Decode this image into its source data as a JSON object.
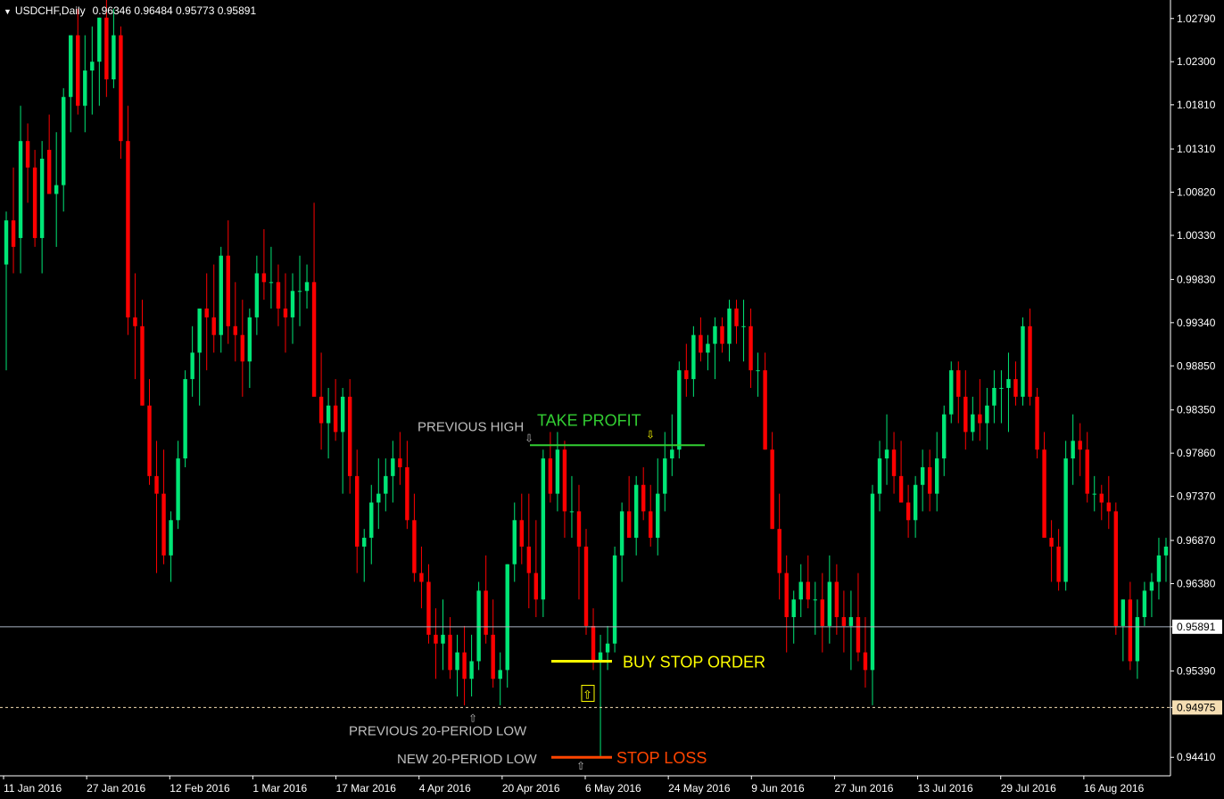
{
  "header": {
    "symbol": "USDCHF,Daily",
    "ohlc": "0.96346 0.96484 0.95773 0.95891"
  },
  "colors": {
    "background": "#000000",
    "bull": "#00E676",
    "bear": "#FF0000",
    "axis": "#FFFFFF",
    "current_price_line": "#A9B4C2",
    "take_profit": "#32CD32",
    "buy_stop": "#FFFF00",
    "stop_loss": "#FF4500",
    "annotation_gray": "#BEBEBE",
    "price_tag_bg": "#F5DEB3"
  },
  "chart_data": {
    "type": "candlestick",
    "symbol": "USDCHF",
    "timeframe": "Daily",
    "ylim": [
      0.942,
      1.03
    ],
    "y_ticks": [
      "1.02790",
      "1.02300",
      "1.01810",
      "1.01310",
      "1.00820",
      "1.00330",
      "0.99830",
      "0.99340",
      "0.98850",
      "0.98350",
      "0.97860",
      "0.97370",
      "0.96870",
      "0.96380",
      "0.95891",
      "0.95390",
      "0.94975",
      "0.94410"
    ],
    "x_labels": [
      "11 Jan 2016",
      "27 Jan 2016",
      "12 Feb 2016",
      "1 Mar 2016",
      "17 Mar 2016",
      "4 Apr 2016",
      "20 Apr 2016",
      "6 May 2016",
      "24 May 2016",
      "9 Jun 2016",
      "27 Jun 2016",
      "13 Jul 2016",
      "29 Jul 2016",
      "16 Aug 2016"
    ],
    "current_price": 0.95891,
    "dotted_level": 0.94975,
    "candles": [
      [
        1.0,
        1.006,
        0.988,
        1.005
      ],
      [
        1.005,
        1.011,
        0.999,
        1.002
      ],
      [
        1.003,
        1.018,
        0.999,
        1.014
      ],
      [
        1.014,
        1.016,
        1.007,
        1.011
      ],
      [
        1.011,
        1.013,
        1.002,
        1.003
      ],
      [
        1.003,
        1.014,
        0.999,
        1.012
      ],
      [
        1.013,
        1.017,
        1.008,
        1.008
      ],
      [
        1.008,
        1.015,
        1.002,
        1.009
      ],
      [
        1.009,
        1.02,
        1.006,
        1.019
      ],
      [
        1.019,
        1.026,
        1.015,
        1.026
      ],
      [
        1.026,
        1.029,
        1.017,
        1.018
      ],
      [
        1.018,
        1.026,
        1.015,
        1.022
      ],
      [
        1.022,
        1.027,
        1.017,
        1.023
      ],
      [
        1.023,
        1.028,
        1.018,
        1.028
      ],
      [
        1.028,
        1.034,
        1.019,
        1.021
      ],
      [
        1.021,
        1.029,
        1.02,
        1.026
      ],
      [
        1.026,
        1.027,
        1.012,
        1.014
      ],
      [
        1.014,
        1.018,
        0.992,
        0.994
      ],
      [
        0.994,
        0.999,
        0.987,
        0.993
      ],
      [
        0.993,
        0.996,
        0.984,
        0.984
      ],
      [
        0.984,
        0.987,
        0.975,
        0.976
      ],
      [
        0.976,
        0.98,
        0.965,
        0.974
      ],
      [
        0.974,
        0.979,
        0.966,
        0.967
      ],
      [
        0.967,
        0.972,
        0.964,
        0.971
      ],
      [
        0.971,
        0.98,
        0.97,
        0.978
      ],
      [
        0.978,
        0.988,
        0.977,
        0.987
      ],
      [
        0.987,
        0.993,
        0.985,
        0.99
      ],
      [
        0.99,
        0.995,
        0.984,
        0.995
      ],
      [
        0.995,
        0.999,
        0.988,
        0.994
      ],
      [
        0.994,
        1.0,
        0.99,
        0.992
      ],
      [
        0.992,
        1.002,
        0.99,
        1.001
      ],
      [
        1.001,
        1.005,
        0.991,
        0.993
      ],
      [
        0.993,
        0.998,
        0.989,
        0.992
      ],
      [
        0.992,
        0.996,
        0.985,
        0.989
      ],
      [
        0.989,
        0.995,
        0.986,
        0.994
      ],
      [
        0.994,
        1.001,
        0.992,
        0.999
      ],
      [
        0.999,
        1.004,
        0.996,
        0.998
      ],
      [
        0.998,
        1.002,
        0.995,
        0.998
      ],
      [
        0.998,
        1.0,
        0.993,
        0.995
      ],
      [
        0.995,
        0.999,
        0.99,
        0.994
      ],
      [
        0.994,
        0.999,
        0.991,
        0.997
      ],
      [
        0.997,
        1.001,
        0.993,
        0.997
      ],
      [
        0.997,
        1.0,
        0.995,
        0.998
      ],
      [
        0.998,
        1.007,
        0.991,
        0.985
      ],
      [
        0.985,
        0.99,
        0.979,
        0.982
      ],
      [
        0.982,
        0.986,
        0.978,
        0.984
      ],
      [
        0.984,
        0.987,
        0.98,
        0.981
      ],
      [
        0.981,
        0.986,
        0.974,
        0.985
      ],
      [
        0.985,
        0.987,
        0.974,
        0.976
      ],
      [
        0.976,
        0.979,
        0.965,
        0.968
      ],
      [
        0.968,
        0.97,
        0.964,
        0.969
      ],
      [
        0.969,
        0.975,
        0.966,
        0.973
      ],
      [
        0.973,
        0.978,
        0.97,
        0.974
      ],
      [
        0.974,
        0.978,
        0.972,
        0.976
      ],
      [
        0.976,
        0.98,
        0.973,
        0.978
      ],
      [
        0.978,
        0.981,
        0.975,
        0.977
      ],
      [
        0.977,
        0.98,
        0.97,
        0.971
      ],
      [
        0.971,
        0.974,
        0.964,
        0.965
      ],
      [
        0.965,
        0.968,
        0.961,
        0.964
      ],
      [
        0.964,
        0.966,
        0.957,
        0.958
      ],
      [
        0.958,
        0.961,
        0.953,
        0.957
      ],
      [
        0.957,
        0.962,
        0.954,
        0.958
      ],
      [
        0.958,
        0.96,
        0.953,
        0.954
      ],
      [
        0.954,
        0.958,
        0.951,
        0.956
      ],
      [
        0.956,
        0.959,
        0.95,
        0.953
      ],
      [
        0.953,
        0.958,
        0.951,
        0.955
      ],
      [
        0.955,
        0.964,
        0.954,
        0.963
      ],
      [
        0.963,
        0.967,
        0.957,
        0.958
      ],
      [
        0.958,
        0.962,
        0.952,
        0.953
      ],
      [
        0.953,
        0.956,
        0.95,
        0.954
      ],
      [
        0.954,
        0.966,
        0.952,
        0.966
      ],
      [
        0.966,
        0.973,
        0.964,
        0.971
      ],
      [
        0.971,
        0.974,
        0.966,
        0.968
      ],
      [
        0.968,
        0.974,
        0.961,
        0.965
      ],
      [
        0.965,
        0.971,
        0.96,
        0.962
      ],
      [
        0.962,
        0.979,
        0.96,
        0.978
      ],
      [
        0.978,
        0.981,
        0.973,
        0.974
      ],
      [
        0.974,
        0.981,
        0.972,
        0.979
      ],
      [
        0.979,
        0.98,
        0.969,
        0.972
      ],
      [
        0.972,
        0.976,
        0.969,
        0.972
      ],
      [
        0.972,
        0.975,
        0.962,
        0.968
      ],
      [
        0.968,
        0.97,
        0.958,
        0.959
      ],
      [
        0.959,
        0.961,
        0.954,
        0.955
      ],
      [
        0.955,
        0.958,
        0.944,
        0.956
      ],
      [
        0.956,
        0.959,
        0.954,
        0.957
      ],
      [
        0.957,
        0.968,
        0.956,
        0.967
      ],
      [
        0.967,
        0.973,
        0.964,
        0.972
      ],
      [
        0.972,
        0.976,
        0.969,
        0.969
      ],
      [
        0.969,
        0.976,
        0.967,
        0.975
      ],
      [
        0.975,
        0.977,
        0.971,
        0.972
      ],
      [
        0.972,
        0.975,
        0.968,
        0.969
      ],
      [
        0.969,
        0.978,
        0.967,
        0.974
      ],
      [
        0.974,
        0.981,
        0.972,
        0.978
      ],
      [
        0.978,
        0.983,
        0.976,
        0.979
      ],
      [
        0.979,
        0.989,
        0.978,
        0.988
      ],
      [
        0.988,
        0.991,
        0.985,
        0.987
      ],
      [
        0.987,
        0.993,
        0.985,
        0.992
      ],
      [
        0.992,
        0.994,
        0.989,
        0.99
      ],
      [
        0.99,
        0.992,
        0.988,
        0.991
      ],
      [
        0.991,
        0.994,
        0.987,
        0.993
      ],
      [
        0.993,
        0.994,
        0.99,
        0.991
      ],
      [
        0.991,
        0.996,
        0.989,
        0.995
      ],
      [
        0.995,
        0.996,
        0.991,
        0.993
      ],
      [
        0.993,
        0.996,
        0.989,
        0.993
      ],
      [
        0.993,
        0.995,
        0.986,
        0.988
      ],
      [
        0.988,
        0.99,
        0.985,
        0.988
      ],
      [
        0.988,
        0.99,
        0.979,
        0.979
      ],
      [
        0.979,
        0.981,
        0.97,
        0.97
      ],
      [
        0.97,
        0.974,
        0.962,
        0.965
      ],
      [
        0.965,
        0.967,
        0.956,
        0.96
      ],
      [
        0.96,
        0.963,
        0.957,
        0.962
      ],
      [
        0.962,
        0.966,
        0.96,
        0.964
      ],
      [
        0.964,
        0.967,
        0.961,
        0.962
      ],
      [
        0.962,
        0.964,
        0.958,
        0.962
      ],
      [
        0.962,
        0.965,
        0.956,
        0.959
      ],
      [
        0.959,
        0.967,
        0.957,
        0.964
      ],
      [
        0.964,
        0.966,
        0.958,
        0.96
      ],
      [
        0.96,
        0.963,
        0.956,
        0.959
      ],
      [
        0.959,
        0.963,
        0.954,
        0.96
      ],
      [
        0.96,
        0.965,
        0.955,
        0.956
      ],
      [
        0.956,
        0.96,
        0.952,
        0.954
      ],
      [
        0.954,
        0.975,
        0.95,
        0.974
      ],
      [
        0.974,
        0.98,
        0.972,
        0.978
      ],
      [
        0.978,
        0.983,
        0.975,
        0.979
      ],
      [
        0.979,
        0.981,
        0.974,
        0.976
      ],
      [
        0.976,
        0.98,
        0.973,
        0.973
      ],
      [
        0.973,
        0.975,
        0.969,
        0.971
      ],
      [
        0.971,
        0.976,
        0.969,
        0.975
      ],
      [
        0.975,
        0.979,
        0.972,
        0.977
      ],
      [
        0.977,
        0.979,
        0.972,
        0.974
      ],
      [
        0.974,
        0.981,
        0.972,
        0.978
      ],
      [
        0.978,
        0.984,
        0.976,
        0.983
      ],
      [
        0.983,
        0.989,
        0.982,
        0.988
      ],
      [
        0.988,
        0.989,
        0.982,
        0.985
      ],
      [
        0.985,
        0.988,
        0.979,
        0.981
      ],
      [
        0.981,
        0.985,
        0.98,
        0.983
      ],
      [
        0.983,
        0.987,
        0.98,
        0.982
      ],
      [
        0.982,
        0.986,
        0.979,
        0.984
      ],
      [
        0.984,
        0.988,
        0.982,
        0.986
      ],
      [
        0.986,
        0.988,
        0.982,
        0.986
      ],
      [
        0.986,
        0.99,
        0.981,
        0.987
      ],
      [
        0.987,
        0.989,
        0.984,
        0.985
      ],
      [
        0.985,
        0.994,
        0.984,
        0.993
      ],
      [
        0.993,
        0.995,
        0.984,
        0.985
      ],
      [
        0.985,
        0.986,
        0.978,
        0.979
      ],
      [
        0.979,
        0.981,
        0.969,
        0.969
      ],
      [
        0.969,
        0.971,
        0.964,
        0.968
      ],
      [
        0.968,
        0.97,
        0.963,
        0.964
      ],
      [
        0.964,
        0.98,
        0.963,
        0.978
      ],
      [
        0.978,
        0.983,
        0.975,
        0.98
      ],
      [
        0.98,
        0.982,
        0.976,
        0.979
      ],
      [
        0.979,
        0.981,
        0.973,
        0.974
      ],
      [
        0.974,
        0.976,
        0.972,
        0.974
      ],
      [
        0.974,
        0.975,
        0.971,
        0.973
      ],
      [
        0.973,
        0.976,
        0.97,
        0.972
      ],
      [
        0.972,
        0.973,
        0.958,
        0.959
      ],
      [
        0.959,
        0.962,
        0.955,
        0.962
      ],
      [
        0.962,
        0.964,
        0.954,
        0.955
      ],
      [
        0.955,
        0.962,
        0.953,
        0.96
      ],
      [
        0.96,
        0.964,
        0.959,
        0.963
      ],
      [
        0.963,
        0.965,
        0.96,
        0.964
      ],
      [
        0.964,
        0.969,
        0.962,
        0.967
      ],
      [
        0.967,
        0.969,
        0.964,
        0.968
      ]
    ],
    "annotations": {
      "take_profit": {
        "label": "TAKE PROFIT",
        "price": 0.9795
      },
      "previous_high": {
        "label": "PREVIOUS HIGH",
        "price": 0.9795
      },
      "buy_stop": {
        "label": "BUY STOP ORDER",
        "price": 0.955
      },
      "stop_loss": {
        "label": "STOP LOSS",
        "price": 0.9441
      },
      "previous_low": {
        "label": "PREVIOUS 20-PERIOD LOW",
        "price": 0.94975
      },
      "new_low": {
        "label": "NEW 20-PERIOD LOW",
        "price": 0.9441
      }
    }
  }
}
